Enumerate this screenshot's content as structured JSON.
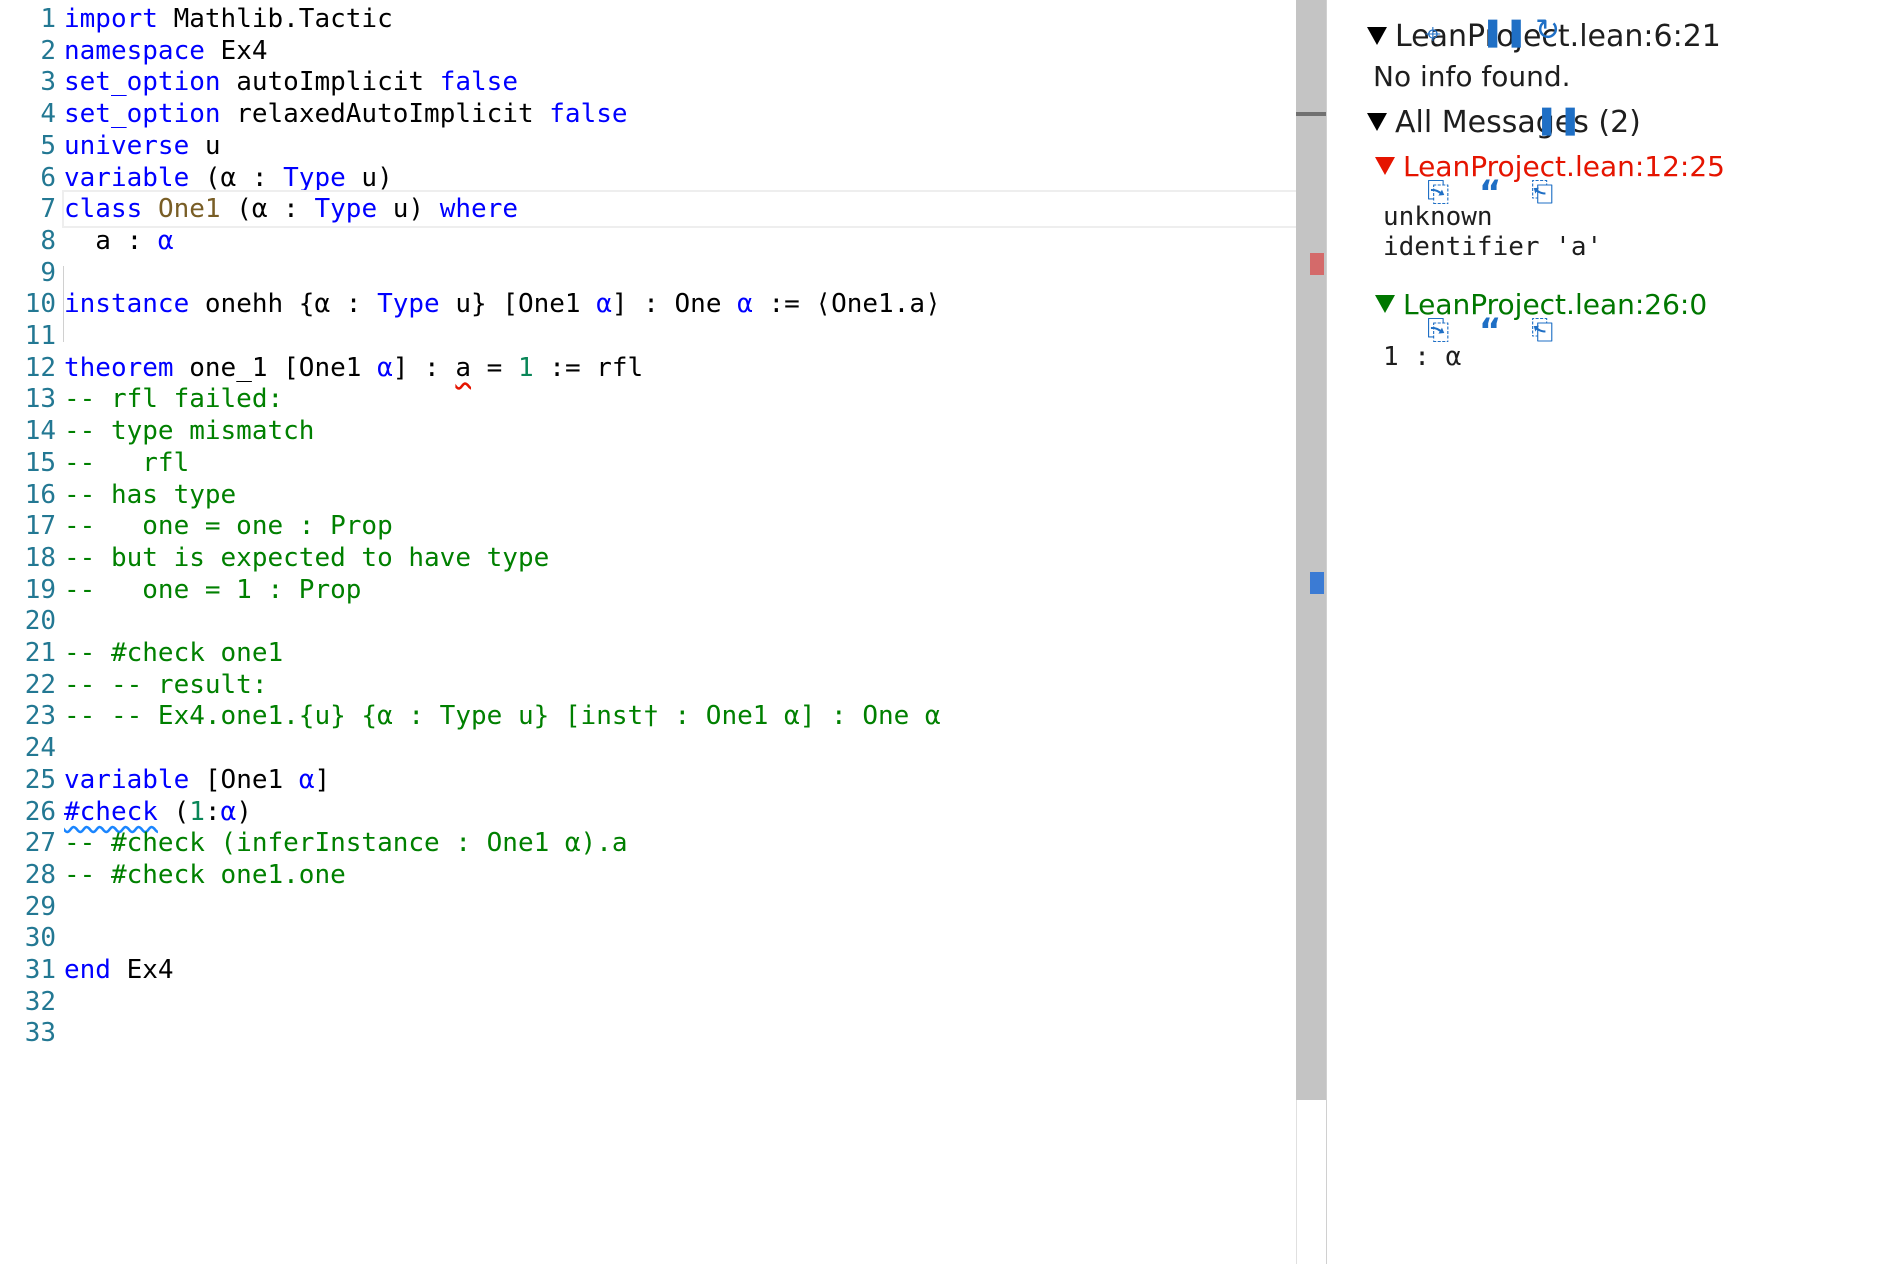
{
  "editor": {
    "lines": [
      {
        "n": "1",
        "tokens": [
          {
            "t": "import",
            "c": "kw"
          },
          {
            "t": " Mathlib.Tactic",
            "c": "code"
          }
        ]
      },
      {
        "n": "2",
        "tokens": [
          {
            "t": "namespace",
            "c": "kw"
          },
          {
            "t": " Ex4",
            "c": "code"
          }
        ]
      },
      {
        "n": "3",
        "tokens": [
          {
            "t": "set_option",
            "c": "kw"
          },
          {
            "t": " autoImplicit ",
            "c": "code"
          },
          {
            "t": "false",
            "c": "kw"
          }
        ]
      },
      {
        "n": "4",
        "tokens": [
          {
            "t": "set_option",
            "c": "kw"
          },
          {
            "t": " relaxedAutoImplicit ",
            "c": "code"
          },
          {
            "t": "false",
            "c": "kw"
          }
        ]
      },
      {
        "n": "5",
        "tokens": [
          {
            "t": "universe",
            "c": "kw"
          },
          {
            "t": " u",
            "c": "code"
          }
        ]
      },
      {
        "n": "6",
        "tokens": [
          {
            "t": "variable",
            "c": "kw"
          },
          {
            "t": " (α : ",
            "c": "code"
          },
          {
            "t": "Type",
            "c": "kw"
          },
          {
            "t": " u)",
            "c": "code"
          }
        ]
      },
      {
        "n": "7",
        "tokens": [
          {
            "t": "class",
            "c": "kw"
          },
          {
            "t": " ",
            "c": "code"
          },
          {
            "t": "One1",
            "c": "cls"
          },
          {
            "t": " (α : ",
            "c": "code"
          },
          {
            "t": "Type",
            "c": "kw"
          },
          {
            "t": " u) ",
            "c": "code"
          },
          {
            "t": "where",
            "c": "kw"
          }
        ]
      },
      {
        "n": "8",
        "tokens": [
          {
            "t": "  a : ",
            "c": "code"
          },
          {
            "t": "α",
            "c": "kw"
          }
        ]
      },
      {
        "n": "9",
        "tokens": []
      },
      {
        "n": "10",
        "tokens": [
          {
            "t": "instance",
            "c": "kw"
          },
          {
            "t": " onehh {α : ",
            "c": "code"
          },
          {
            "t": "Type",
            "c": "kw"
          },
          {
            "t": " u} [One1 ",
            "c": "code"
          },
          {
            "t": "α",
            "c": "kw"
          },
          {
            "t": "] : One ",
            "c": "code"
          },
          {
            "t": "α",
            "c": "kw"
          },
          {
            "t": " := ⟨One1.a⟩",
            "c": "code"
          }
        ]
      },
      {
        "n": "11",
        "tokens": []
      },
      {
        "n": "12",
        "tokens": [
          {
            "t": "theorem",
            "c": "kw"
          },
          {
            "t": " one_1 [One1 ",
            "c": "code"
          },
          {
            "t": "α",
            "c": "kw"
          },
          {
            "t": "] : ",
            "c": "code"
          },
          {
            "t": "a",
            "c": "code err-squiggle"
          },
          {
            "t": " = ",
            "c": "code"
          },
          {
            "t": "1",
            "c": "num"
          },
          {
            "t": " := rfl",
            "c": "code"
          }
        ]
      },
      {
        "n": "13",
        "tokens": [
          {
            "t": "-- rfl failed:",
            "c": "cm"
          }
        ]
      },
      {
        "n": "14",
        "tokens": [
          {
            "t": "-- type mismatch",
            "c": "cm"
          }
        ]
      },
      {
        "n": "15",
        "tokens": [
          {
            "t": "--   rfl",
            "c": "cm"
          }
        ]
      },
      {
        "n": "16",
        "tokens": [
          {
            "t": "-- has type",
            "c": "cm"
          }
        ]
      },
      {
        "n": "17",
        "tokens": [
          {
            "t": "--   one = one : Prop",
            "c": "cm"
          }
        ]
      },
      {
        "n": "18",
        "tokens": [
          {
            "t": "-- but is expected to have type",
            "c": "cm"
          }
        ]
      },
      {
        "n": "19",
        "tokens": [
          {
            "t": "--   one = 1 : Prop",
            "c": "cm"
          }
        ]
      },
      {
        "n": "20",
        "tokens": []
      },
      {
        "n": "21",
        "tokens": [
          {
            "t": "-- #check one1",
            "c": "cm"
          }
        ]
      },
      {
        "n": "22",
        "tokens": [
          {
            "t": "-- -- result:",
            "c": "cm"
          }
        ]
      },
      {
        "n": "23",
        "tokens": [
          {
            "t": "-- -- Ex4.one1.{u} {α : Type u} [inst† : One1 α] : One α",
            "c": "cm"
          }
        ]
      },
      {
        "n": "24",
        "tokens": []
      },
      {
        "n": "25",
        "tokens": [
          {
            "t": "variable",
            "c": "kw"
          },
          {
            "t": " [One1 ",
            "c": "code"
          },
          {
            "t": "α",
            "c": "kw"
          },
          {
            "t": "]",
            "c": "code"
          }
        ]
      },
      {
        "n": "26",
        "tokens": [
          {
            "t": "#check",
            "c": "kw info-squiggle"
          },
          {
            "t": " (",
            "c": "code"
          },
          {
            "t": "1",
            "c": "num"
          },
          {
            "t": ":",
            "c": "code"
          },
          {
            "t": "α",
            "c": "kw"
          },
          {
            "t": ")",
            "c": "code"
          }
        ]
      },
      {
        "n": "27",
        "tokens": [
          {
            "t": "-- #check (inferInstance : One1 α).a",
            "c": "cm"
          }
        ]
      },
      {
        "n": "28",
        "tokens": [
          {
            "t": "-- #check one1.one",
            "c": "cm"
          }
        ]
      },
      {
        "n": "29",
        "tokens": []
      },
      {
        "n": "30",
        "tokens": []
      },
      {
        "n": "31",
        "tokens": [
          {
            "t": "end",
            "c": "kw"
          },
          {
            "t": " Ex4",
            "c": "code"
          }
        ]
      },
      {
        "n": "32",
        "tokens": []
      },
      {
        "n": "33",
        "tokens": []
      }
    ]
  },
  "infoview": {
    "goal_header": "LeanProject.lean:6:21",
    "goal_body": "No info found.",
    "messages_header": "All Messages (2)",
    "messages": [
      {
        "location": "LeanProject.lean:12:25",
        "severity": "error",
        "color": "#e51400",
        "text_line1": "unknown",
        "text_line2": "identifier 'a'"
      },
      {
        "location": "LeanProject.lean:26:0",
        "severity": "info",
        "color": "#007700",
        "text_line1": "1 : α",
        "text_line2": ""
      }
    ],
    "icons": {
      "pin": "pin-icon",
      "pause": "pause-icon",
      "refresh": "refresh-icon",
      "goto": "go-to-file-icon",
      "quote": "quote-icon",
      "copy": "copy-to-comment-icon"
    }
  }
}
